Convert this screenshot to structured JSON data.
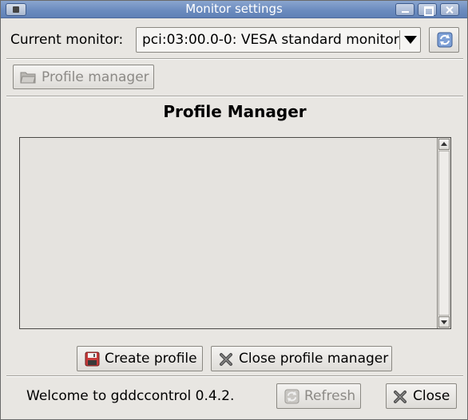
{
  "window": {
    "title": "Monitor settings"
  },
  "monitor": {
    "label": "Current monitor:",
    "selected": "pci:03:00.0-0: VESA standard monitor"
  },
  "toolbar": {
    "profile_manager_label": "Profile manager"
  },
  "profile_manager": {
    "heading": "Profile Manager",
    "create_label": "Create profile",
    "close_label": "Close profile manager"
  },
  "footer": {
    "status": "Welcome to gddccontrol 0.4.2.",
    "refresh_label": "Refresh",
    "close_label": "Close"
  },
  "colors": {
    "titlebar": "#6c8cbf",
    "window_bg": "#e8e6e2"
  }
}
